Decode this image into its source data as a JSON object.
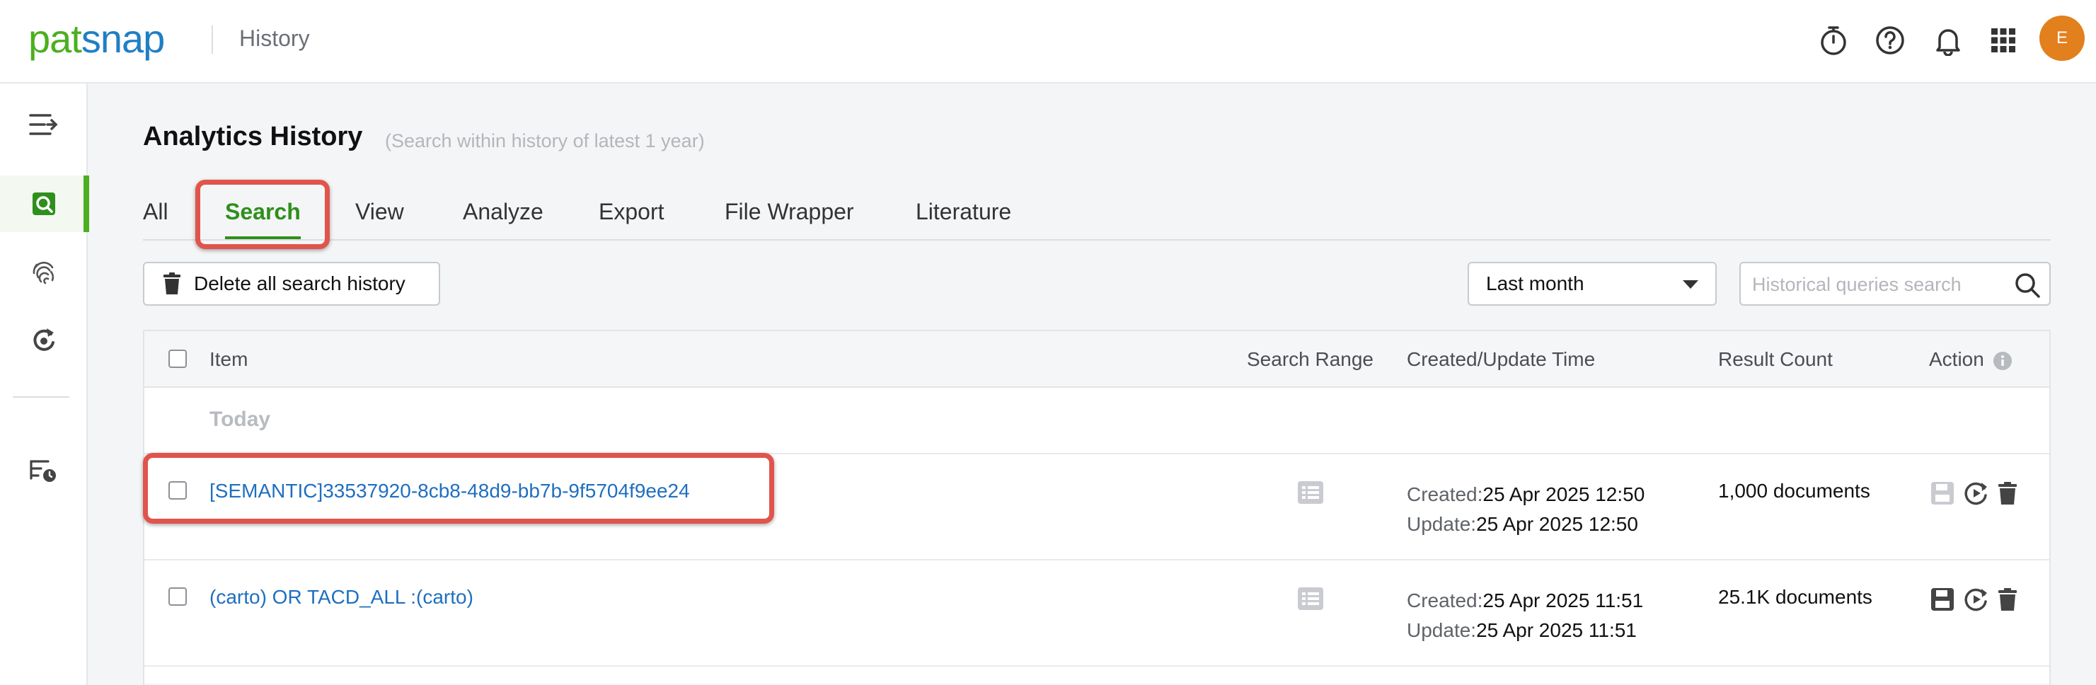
{
  "header": {
    "logo_part1": "pat",
    "logo_part2": "snap",
    "page": "History",
    "avatar_initial": "E"
  },
  "page": {
    "title": "Analytics History",
    "subtitle": "(Search within history of latest 1 year)"
  },
  "tabs": [
    {
      "label": "All"
    },
    {
      "label": "Search",
      "active": true
    },
    {
      "label": "View"
    },
    {
      "label": "Analyze"
    },
    {
      "label": "Export"
    },
    {
      "label": "File Wrapper"
    },
    {
      "label": "Literature"
    }
  ],
  "toolbar": {
    "delete_all_label": "Delete all search history",
    "range_select_value": "Last month",
    "search_placeholder": "Historical queries search"
  },
  "table": {
    "columns": {
      "item": "Item",
      "search_range": "Search Range",
      "time": "Created/Update Time",
      "result_count": "Result Count",
      "action": "Action"
    },
    "group_label": "Today",
    "rows": [
      {
        "item": "[SEMANTIC]33537920-8cb8-48d9-bb7b-9f5704f9ee24",
        "created_key": "Created:",
        "created": "25 Apr 2025 12:50",
        "update_key": "Update:",
        "updated": "25 Apr 2025 12:50",
        "count": "1,000 documents"
      },
      {
        "item": "(carto) OR TACD_ALL :(carto)",
        "created_key": "Created:",
        "created": "25 Apr 2025 11:51",
        "update_key": "Update:",
        "updated": "25 Apr 2025 11:51",
        "count": "25.1K documents"
      }
    ]
  },
  "colors": {
    "brand_green": "#4caf1f",
    "brand_blue": "#1f7fc4",
    "active_tab": "#2f8f1c",
    "link": "#1f6fc0",
    "highlight": "#e0544b",
    "avatar": "#e2801e"
  },
  "icons": {
    "timer": "stopwatch-icon",
    "help": "help-circle-icon",
    "notify": "bell-icon",
    "apps": "grid-apps-icon",
    "collapse": "menu-collapse-icon",
    "search_history": "search-history-icon",
    "fingerprint": "fingerprint-icon",
    "refresh": "refresh-icon",
    "scheduled": "scheduled-history-icon",
    "trash": "trash-icon",
    "save": "save-icon",
    "rerun": "rerun-icon",
    "list": "list-icon",
    "info": "info-icon",
    "dropdown": "caret-down-icon"
  }
}
